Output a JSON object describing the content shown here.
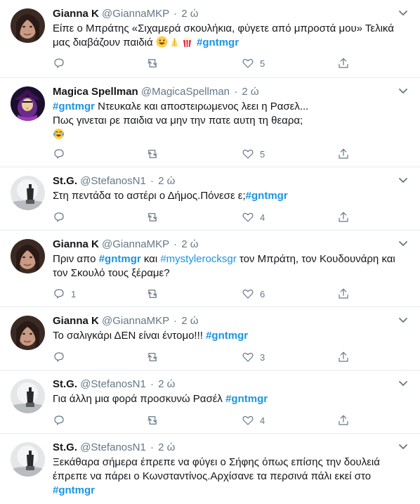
{
  "tweets": [
    {
      "name": "Gianna K",
      "handle": "@GiannaMKP",
      "time": "2 ώ",
      "text_before": "Είπε ο Μπράτης «Σιχαμερά σκουλήκια, φύγετε από μπροστά μου» Τελικά μας διαβάζουν παιδιά ",
      "hashtag": "#gntmgr",
      "likes": "5",
      "avatar": "woman-avatar"
    },
    {
      "name": "Magica Spellman",
      "handle": "@MagicaSpellman",
      "time": "2 ώ",
      "hashtag": "#gntmgr",
      "text_after": " Ντευκαλε και αποστειρωμενος λεει η Ρασελ...",
      "line2": "Πως γινεται ρε παιδια να μην την πατε αυτη τη θεαρα;",
      "likes": "5",
      "avatar": "magica-avatar"
    },
    {
      "name": "St.G.",
      "handle": "@StefanosN1",
      "time": "2 ώ",
      "text_before": "Στη πεντάδα το αστέρι ο Δήμος.Πόνεσε ε;",
      "hashtag": "#gntmgr",
      "likes": "4",
      "avatar": "statue-avatar"
    },
    {
      "name": "Gianna K",
      "handle": "@GiannaMKP",
      "time": "2 ώ",
      "text_before": "Πριν απο ",
      "hashtag": "#gntmgr",
      "mid": " και ",
      "hashtag2": "#mystylerocksgr",
      "text_after": "  τον Μπράτη, τον Κουδουνάρη και τον Σκουλό τους ξέραμε?",
      "replies": "1",
      "likes": "6",
      "avatar": "woman-avatar"
    },
    {
      "name": "Gianna K",
      "handle": "@GiannaMKP",
      "time": "2 ώ",
      "text_before": "Το σαλιγκάρι ΔΕΝ είναι έντομο!!! ",
      "hashtag": "#gntmgr",
      "likes": "3",
      "avatar": "woman-avatar"
    },
    {
      "name": "St.G.",
      "handle": "@StefanosN1",
      "time": "2 ώ",
      "text_before": "Για άλλη μια φορά προσκυνώ Ρασέλ ",
      "hashtag": "#gntmgr",
      "likes": "4",
      "avatar": "statue-avatar"
    },
    {
      "name": "St.G.",
      "handle": "@StefanosN1",
      "time": "2 ώ",
      "text_before": "Ξεκάθαρα σήμερα έπρεπε να φύγει ο Σήφης όπως επίσης την δουλειά έπρεπε να πάρει ο Κωνσταντίνος.Αρχίσανε τα περσινά πάλι εκεί στο",
      "hashtag": "#gntmgr",
      "avatar": "statue-avatar"
    }
  ],
  "dot": "·",
  "colors": {
    "link": "#1b95e0",
    "muted": "#657786",
    "divider": "#e6ecf0"
  }
}
